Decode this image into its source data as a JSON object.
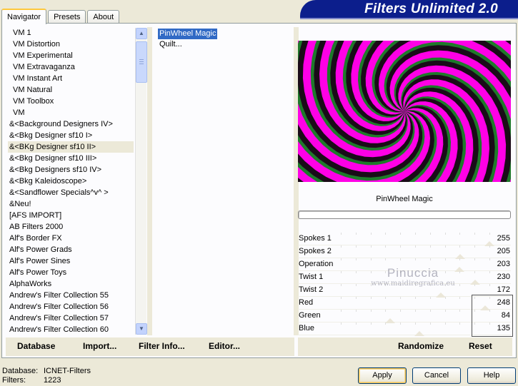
{
  "tabs": [
    "Navigator",
    "Presets",
    "About"
  ],
  "banner_title": "Filters Unlimited 2.0",
  "categories": [
    "VM 1",
    "VM Distortion",
    "VM Experimental",
    "VM Extravaganza",
    "VM Instant Art",
    "VM Natural",
    "VM Toolbox",
    "VM",
    "&<Background Designers IV>",
    "&<Bkg Designer sf10 I>",
    "&<BKg Designer sf10 II>",
    "&<Bkg Designer sf10 III>",
    "&<Bkg Designers sf10 IV>",
    "&<Bkg Kaleidoscope>",
    "&<Sandflower Specials^v^ >",
    "&Neu!",
    "[AFS IMPORT]",
    "AB Filters 2000",
    "Alf's Border FX",
    "Alf's Power Grads",
    "Alf's Power Sines",
    "Alf's Power Toys",
    "AlphaWorks",
    "Andrew's Filter Collection 55",
    "Andrew's Filter Collection 56",
    "Andrew's Filter Collection 57",
    "Andrew's Filter Collection 60"
  ],
  "selected_category": "&<BKg Designer sf10 II>",
  "filters": [
    "PinWheel Magic",
    "Quilt..."
  ],
  "selected_filter": "PinWheel Magic",
  "preview_caption": "PinWheel Magic",
  "progress": 0,
  "sliders": [
    {
      "label": "Spokes 1",
      "value": "255",
      "max": 255
    },
    {
      "label": "Spokes 2",
      "value": "205",
      "max": 255
    },
    {
      "label": "Operation",
      "value": "203",
      "max": 255
    },
    {
      "label": "Twist 1",
      "value": "230",
      "max": 255
    },
    {
      "label": "Twist 2",
      "value": "172",
      "max": 255
    },
    {
      "label": "Red",
      "value": "248",
      "max": 255
    },
    {
      "label": "Green",
      "value": "84",
      "max": 255
    },
    {
      "label": "Blue",
      "value": "135",
      "max": 255
    }
  ],
  "watermark": {
    "line1": "Pinuccia",
    "line2": "www.maidiregrafica.eu"
  },
  "toolbar": {
    "database": "Database",
    "import": "Import...",
    "filter_info": "Filter Info...",
    "editor": "Editor...",
    "randomize": "Randomize",
    "reset": "Reset"
  },
  "status": {
    "database_label": "Database:",
    "database_value": "ICNET-Filters",
    "filters_label": "Filters:",
    "filters_value": "1223"
  },
  "buttons": {
    "apply": "Apply",
    "cancel": "Cancel",
    "help": "Help"
  },
  "colors": {
    "banner": "#0c1e8c",
    "selection": "#316ac5",
    "pinwheel_magenta": "#ff00e6",
    "pinwheel_green": "#1e7a2a"
  }
}
